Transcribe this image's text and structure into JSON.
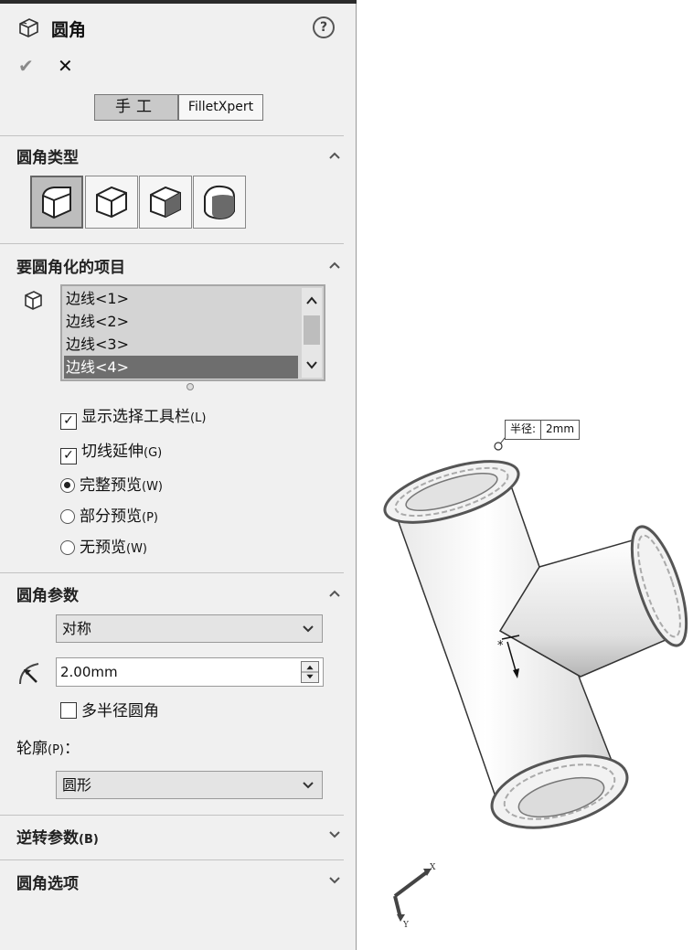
{
  "feature": {
    "title": "圆角",
    "help": "?",
    "ok_symbol": "✔",
    "cancel_symbol": "✕"
  },
  "mode": {
    "manual_label": "手工",
    "xpert_label": "FilletXpert",
    "selected": "手工"
  },
  "sections": {
    "fillet_type": {
      "title": "圆角类型",
      "expanded": true
    },
    "items": {
      "title": "要圆角化的项目",
      "expanded": true,
      "edges": [
        "边线<1>",
        "边线<2>",
        "边线<3>",
        "边线<4>"
      ],
      "selected_index": 3,
      "options": {
        "show_toolbar": {
          "label": "显示选择工具栏",
          "shortcut": "(L)",
          "checked": true
        },
        "tangent": {
          "label": "切线延伸",
          "shortcut": "(G)",
          "checked": true
        },
        "full_preview": {
          "label": "完整预览",
          "shortcut": "(W)",
          "selected": true
        },
        "partial_preview": {
          "label": "部分预览",
          "shortcut": "(P)",
          "selected": false
        },
        "no_preview": {
          "label": "无预览",
          "shortcut": "(W)",
          "selected": false
        }
      }
    },
    "params": {
      "title": "圆角参数",
      "expanded": true,
      "method": "对称",
      "radius": "2.00mm",
      "multi_radius": {
        "label": "多半径圆角",
        "checked": false
      },
      "profile_label": "轮廓",
      "profile_shortcut": "(P)",
      "profile_colon": "：",
      "profile_value": "圆形"
    },
    "setback": {
      "title": "逆转参数",
      "shortcut": "(B)",
      "expanded": false
    },
    "options": {
      "title": "圆角选项",
      "expanded": false
    }
  },
  "viewport": {
    "radius_callout_label": "半径:",
    "radius_callout_value": "2mm",
    "triad_x": "X",
    "triad_y": "Y"
  }
}
